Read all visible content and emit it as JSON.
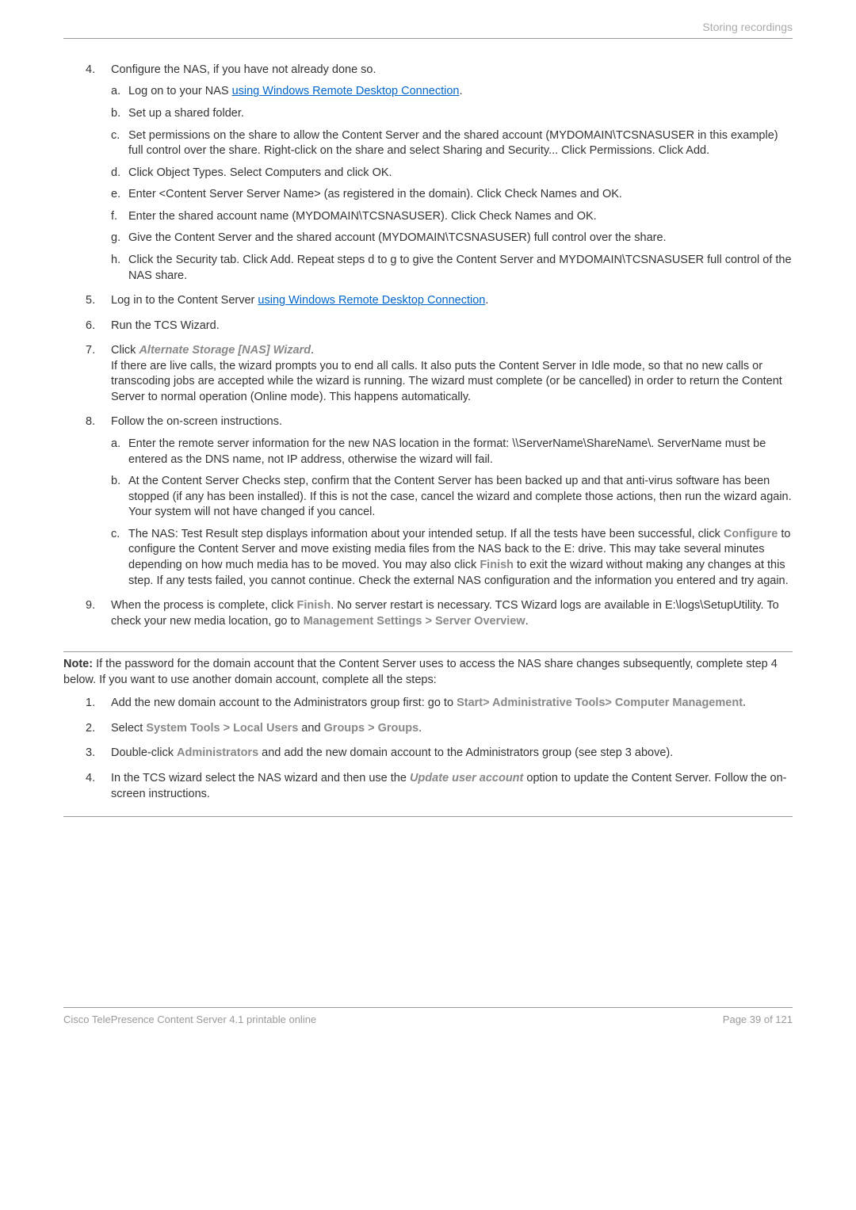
{
  "header": {
    "section_label": "Storing recordings"
  },
  "list1": {
    "item4": {
      "text": "Configure the NAS, if you have not already done so.",
      "a_pre": "Log on to your NAS ",
      "a_link": "using Windows Remote Desktop Connection",
      "a_post": ".",
      "b": "Set up a shared folder.",
      "c": "Set permissions on the share to allow the Content Server and the shared account (MYDOMAIN\\TCSNASUSER in this example) full control over the share. Right-click on the share and select Sharing and Security... Click Permissions. Click Add.",
      "d": "Click Object Types. Select Computers and click OK.",
      "e": "Enter <Content Server Server Name> (as registered in the domain). Click Check Names and OK.",
      "f": "Enter the shared account name (MYDOMAIN\\TCSNASUSER). Click Check Names and OK.",
      "g": "Give the Content Server and the shared account (MYDOMAIN\\TCSNASUSER) full control over the share.",
      "h": "Click the Security tab. Click Add. Repeat steps d to g to give the Content Server and MYDOMAIN\\TCSNASUSER full control of the NAS share."
    },
    "item5": {
      "pre": "Log in to the Content Server ",
      "link": "using Windows Remote Desktop Connection",
      "post": "."
    },
    "item6": "Run the TCS Wizard.",
    "item7": {
      "pre": "Click ",
      "label": "Alternate Storage [NAS] Wizard",
      "post": ".",
      "body": "If there are live calls, the wizard prompts you to end all calls. It also puts the Content Server in Idle mode, so that no new calls or transcoding jobs are accepted while the wizard is running. The wizard must complete (or be cancelled) in order to return the Content Server to normal operation (Online mode). This happens automatically."
    },
    "item8": {
      "text": "Follow the on-screen instructions.",
      "a": "Enter the remote server information for the new NAS location in the format: \\\\ServerName\\ShareName\\. ServerName must be entered as the DNS name, not IP address, otherwise the wizard will fail.",
      "b": "At the Content Server Checks step, confirm that the Content Server has been backed up and that anti-virus software has been stopped (if any has been installed). If this is not the case, cancel the wizard and complete those actions, then run the wizard again. Your system will not have changed if you cancel.",
      "c_p1": "The NAS: Test Result step displays information about your intended setup. If all the tests have been successful, click ",
      "c_lbl1": "Configure",
      "c_p2": " to configure the Content Server and move existing media files from the NAS back to the E: drive. This may take several minutes depending on how much media has to be moved. You may also click ",
      "c_lbl2": "Finish",
      "c_p3": " to exit the wizard without making any changes at this step. If any tests failed, you cannot continue. Check the external NAS configuration and the information you entered and try again."
    },
    "item9": {
      "p1": "When the process is complete, click ",
      "lbl1": "Finish",
      "p2": ". No server restart is necessary. TCS Wizard logs are available in E:\\logs\\SetupUtility. To check your new media location, go to ",
      "lbl2": "Management Settings > Server Overview",
      "p3": "."
    }
  },
  "note": {
    "lead_bold": "Note:",
    "lead_text": " If the password for the domain account that the Content Server uses to access the NAS share changes subsequently, complete step 4 below. If you want to use another domain account, complete all the steps:",
    "n1_pre": "Add the new domain account to the Administrators group first: go to ",
    "n1_lbl": "Start> Administrative Tools> Computer Management.",
    "n2_pre": "Select ",
    "n2_l1": "System Tools > Local Users",
    "n2_mid": " and ",
    "n2_l2": "Groups > Groups",
    "n2_post": ".",
    "n3_pre": "Double-click ",
    "n3_lbl": "Administrators",
    "n3_post": " and add the new domain account to the Administrators group (see step 3 above).",
    "n4_pre": "In the TCS wizard select the NAS wizard and then use the ",
    "n4_lbl": "Update user account",
    "n4_post": " option to update the Content Server. Follow the on-screen instructions."
  },
  "footer": {
    "title": "Cisco TelePresence Content Server 4.1 printable online",
    "page": "Page 39 of 121"
  }
}
